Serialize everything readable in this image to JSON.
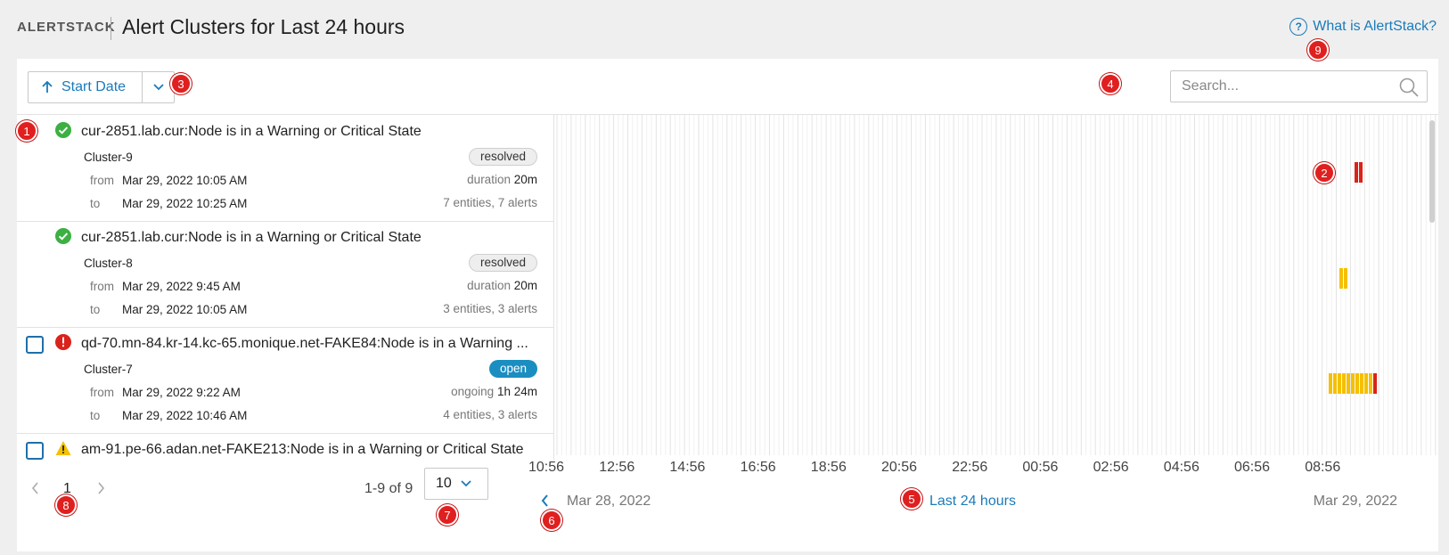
{
  "header": {
    "brand": "ALERTSTACK",
    "title": "Alert Clusters for Last 24 hours",
    "help_link": "What is AlertStack?",
    "help_icon": "question-circle-icon"
  },
  "toolbar": {
    "sort_label": "Start Date",
    "sort_icon": "arrow-up-icon",
    "sort_caret_icon": "chevron-down-icon",
    "search_placeholder": "Search..."
  },
  "clusters": [
    {
      "status": "resolved",
      "status_icon": "check-circle-icon",
      "title": "cur-2851.lab.cur:Node is in a Warning or Critical State",
      "cluster": "Cluster-9",
      "from_label": "from",
      "from": "Mar 29, 2022 10:05 AM",
      "to_label": "to",
      "to": "Mar 29, 2022 10:25 AM",
      "badge": "resolved",
      "duration_label": "duration",
      "duration": "20m",
      "entities": "7 entities, 7 alerts",
      "selectable": false
    },
    {
      "status": "resolved",
      "status_icon": "check-circle-icon",
      "title": "cur-2851.lab.cur:Node is in a Warning or Critical State",
      "cluster": "Cluster-8",
      "from_label": "from",
      "from": "Mar 29, 2022 9:45 AM",
      "to_label": "to",
      "to": "Mar 29, 2022 10:05 AM",
      "badge": "resolved",
      "duration_label": "duration",
      "duration": "20m",
      "entities": "3 entities, 3 alerts",
      "selectable": false
    },
    {
      "status": "critical",
      "status_icon": "critical-icon",
      "title": "qd-70.mn-84.kr-14.kc-65.monique.net-FAKE84:Node is in a Warning ...",
      "cluster": "Cluster-7",
      "from_label": "from",
      "from": "Mar 29, 2022 9:22 AM",
      "to_label": "to",
      "to": "Mar 29, 2022 10:46 AM",
      "badge": "open",
      "duration_label": "ongoing",
      "duration": "1h 24m",
      "entities": "4 entities, 3 alerts",
      "selectable": true
    },
    {
      "status": "warning",
      "status_icon": "warning-icon",
      "title": "am-91.pe-66.adan.net-FAKE213:Node is in a Warning or Critical State",
      "cluster": "",
      "from_label": "",
      "from": "",
      "to_label": "",
      "to": "",
      "badge": "",
      "duration_label": "",
      "duration": "",
      "entities": "",
      "selectable": true
    }
  ],
  "timeline": {
    "ticks": [
      "10:56",
      "12:56",
      "14:56",
      "16:56",
      "18:56",
      "20:56",
      "22:56",
      "00:56",
      "02:56",
      "04:56",
      "06:56",
      "08:56"
    ],
    "start_date": "Mar 28, 2022",
    "range_label": "Last 24 hours",
    "end_date": "Mar 29, 2022",
    "prev_icon": "chevron-left-icon",
    "colors": {
      "warning": "#f5c000",
      "critical": "#d9231b"
    }
  },
  "pagination": {
    "page": "1",
    "range": "1-9 of 9",
    "per_page": "10",
    "prev_icon": "chevron-left-icon",
    "next_icon": "chevron-right-icon"
  },
  "annotations": [
    "1",
    "2",
    "3",
    "4",
    "5",
    "6",
    "7",
    "8",
    "9"
  ]
}
